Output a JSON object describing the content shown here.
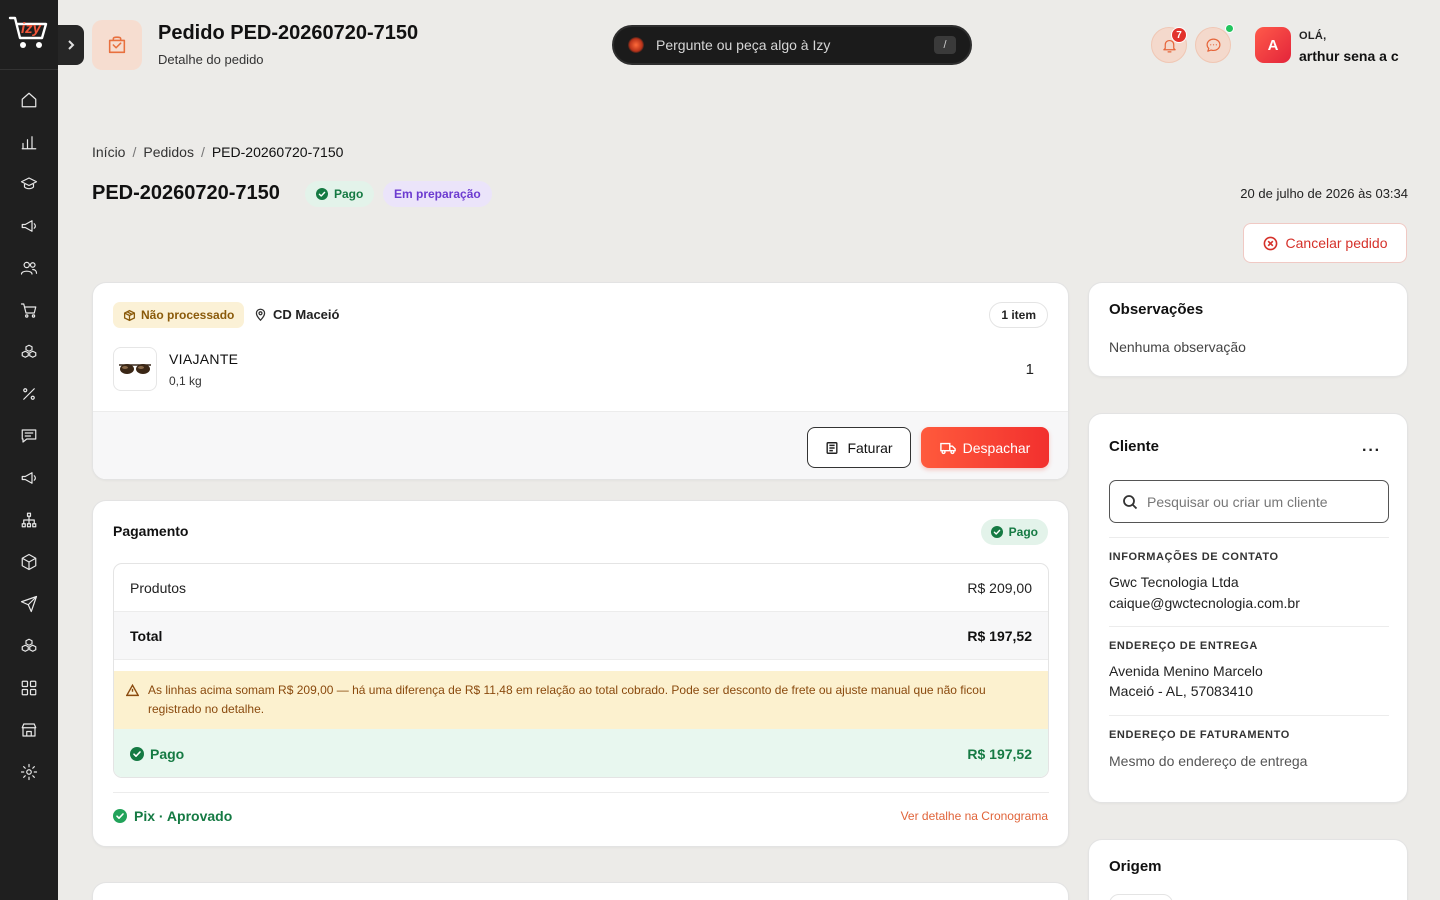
{
  "header": {
    "title": "Pedido PED-20260720-7150",
    "subtitle": "Detalhe do pedido",
    "ask_placeholder": "Pergunte ou peça algo à Izy",
    "ask_shortcut": "/",
    "notifications_count": "7",
    "greeting": "OLÁ,",
    "user_name": "arthur sena a c",
    "avatar_initial": "A"
  },
  "logo": {
    "text": "izy"
  },
  "breadcrumb": {
    "home": "Início",
    "orders": "Pedidos",
    "current": "PED-20260720-7150",
    "separator": "/"
  },
  "order": {
    "id": "PED-20260720-7150",
    "payment_status": "Pago",
    "fulfillment_status": "Em preparação",
    "date": "20 de julho de 2026 às 03:34",
    "cancel_label": "Cancelar pedido"
  },
  "items_card": {
    "processing_tag": "Não processado",
    "location": "CD Maceió",
    "items_count": "1 item",
    "product": {
      "name": "VIAJANTE",
      "weight": "0,1 kg",
      "quantity": "1"
    },
    "invoice_label": "Faturar",
    "dispatch_label": "Despachar"
  },
  "payment": {
    "title": "Pagamento",
    "status": "Pago",
    "products_label": "Produtos",
    "products_value": "R$ 209,00",
    "total_label": "Total",
    "total_value": "R$ 197,52",
    "warning": "As linhas acima somam R$ 209,00 — há uma diferença de R$ 11,48 em relação ao total cobrado. Pode ser desconto de frete ou ajuste manual que não ficou registrado no detalhe.",
    "paid_label": "Pago",
    "paid_value": "R$ 197,52",
    "method": "Pix · Aprovado",
    "detail_link": "Ver detalhe na Cronograma"
  },
  "observations": {
    "title": "Observações",
    "text": "Nenhuma observação"
  },
  "client": {
    "title": "Cliente",
    "more": "···",
    "search_placeholder": "Pesquisar ou criar um cliente",
    "contact_label": "INFORMAÇÕES DE CONTATO",
    "company": "Gwc Tecnologia Ltda",
    "email": "caique@gwctecnologia.com.br",
    "shipping_label": "ENDEREÇO DE ENTREGA",
    "shipping_line1": "Avenida Menino Marcelo",
    "shipping_line2": "Maceió - AL, 57083410",
    "billing_label": "ENDEREÇO DE FATURAMENTO",
    "billing_text": "Mesmo do endereço de entrega"
  },
  "origin": {
    "title": "Origem"
  },
  "colors": {
    "accent": "#f2302e",
    "success": "#157a43",
    "sidebar": "#1f1f1f"
  },
  "sidebar_icons": [
    "home-icon",
    "chart-icon",
    "graduation-cap-icon",
    "megaphone-icon",
    "users-icon",
    "cart-icon",
    "boxes-icon",
    "percent-icon",
    "message-icon",
    "megaphone-icon",
    "network-icon",
    "box-icon",
    "send-icon",
    "boxes-icon",
    "grid-icon",
    "store-icon",
    "gear-icon"
  ]
}
